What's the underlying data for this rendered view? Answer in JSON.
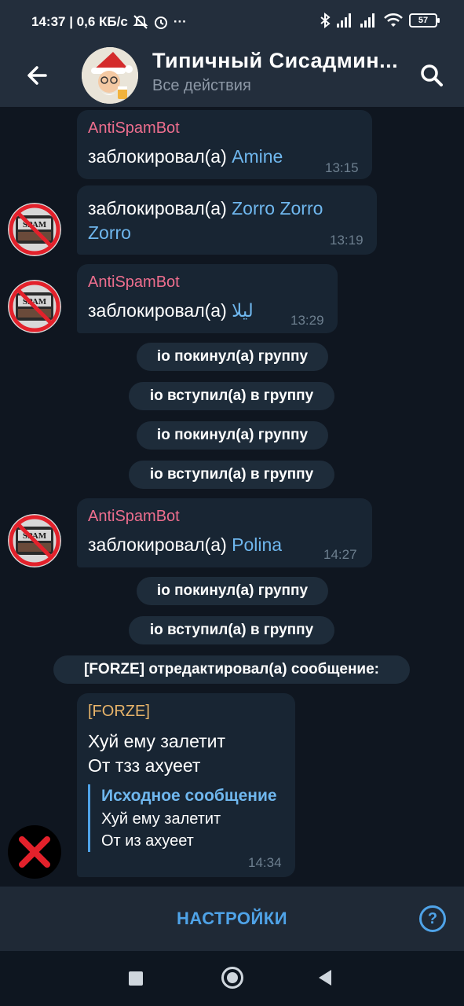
{
  "status_bar": {
    "time_and_speed": "14:37 | 0,6 КБ/с",
    "extra_dots": "···",
    "battery": "57"
  },
  "header": {
    "title": "Типичный Сисадмин...",
    "subtitle": "Все действия"
  },
  "messages": {
    "m1": {
      "sender": "AntiSpamBot",
      "action": "заблокировал(а) ",
      "target": "Amine",
      "time": "13:15"
    },
    "m2": {
      "action": "заблокировал(а) ",
      "target_line1": "Zorro Zorro",
      "target_line2": "Zorro",
      "time": "13:19"
    },
    "m3": {
      "sender": "AntiSpamBot",
      "action": "заблокировал(а) ",
      "target": "ليلا",
      "time": "13:29"
    },
    "m4": {
      "sender": "AntiSpamBot",
      "action": "заблокировал(а) ",
      "target": "Polina",
      "time": "14:27"
    },
    "m5": {
      "sender": "[FORZE]",
      "line1": "Хуй ему залетит",
      "line2": "От тзз ахуеет",
      "quote_title": "Исходное сообщение",
      "quote_line1": "Хуй ему залетит",
      "quote_line2": "От из ахуеет",
      "time": "14:34"
    }
  },
  "service": {
    "s1": "io покинул(а) группу",
    "s2": "io вступил(а) в группу",
    "s3": "io покинул(а) группу",
    "s4": "io вступил(а) в группу",
    "s5": "io покинул(а) группу",
    "s6": "io вступил(а) в группу",
    "s7": "[FORZE] отредактировал(а) сообщение:"
  },
  "avatar_label": "SPAM",
  "bottom": {
    "settings_label": "НАСТРОЙКИ",
    "help_label": "?"
  },
  "colors": {
    "sender_bot": "#ee6e8e",
    "sender_forze": "#e8b46a",
    "link": "#6fb7ee",
    "accent": "#4fa3e8"
  }
}
